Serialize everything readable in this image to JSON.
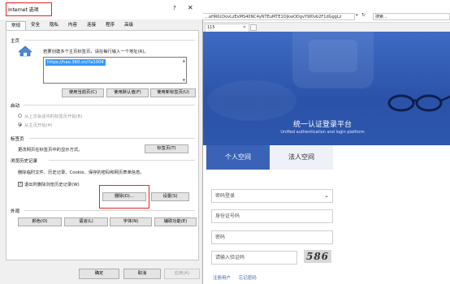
{
  "browser": {
    "url": "…aHR0cDovLzExMS40NC4yNTEuMTE1OjkwODgvYW0vb2F1dGggLz",
    "search_label": "搜索...",
    "tab_label": "115",
    "banner_title": "统一认证登录平台",
    "banner_subtitle": "Unified authentication and login platform",
    "login": {
      "tab_personal": "个人空间",
      "tab_legal": "法人空间",
      "select_value": "密码登录",
      "id_placeholder": "身份证号码",
      "password_placeholder": "密码",
      "captcha_placeholder": "请输入验证码",
      "captcha_text": "586",
      "register_link": "注册用户",
      "forgot_link": "忘记密码"
    }
  },
  "dialog": {
    "title": "Internet 选项",
    "help": "?",
    "close": "✕",
    "tabs": [
      "常规",
      "安全",
      "隐私",
      "内容",
      "连接",
      "程序",
      "高级"
    ],
    "home": {
      "section": "主页",
      "desc": "若要创建多个主页标签页，请在每行输入一个地址(R)。",
      "url": "https://hao.360.cn/?a1004",
      "btn_current": "使用当前页(C)",
      "btn_default": "使用默认值(F)",
      "btn_newtab": "使用新标签页(U)"
    },
    "startup": {
      "section": "启动",
      "opt_last": "从上次会话中的标签页开始(B)",
      "opt_home": "从主页开始(H)"
    },
    "tabs_section": {
      "section": "标签页",
      "desc": "更改网页在标签页中的显示方式。",
      "btn": "标签页(T)"
    },
    "history": {
      "section": "浏览历史记录",
      "desc": "删除临时文件、历史记录、Cookie、保存的密码和网页表单信息。",
      "checkbox": "退出时删除浏览历史记录(W)",
      "btn_delete": "删除(D)...",
      "btn_settings": "设置(S)"
    },
    "appearance": {
      "section": "外观",
      "btn_color": "颜色(O)",
      "btn_language": "语言(L)",
      "btn_font": "字体(N)",
      "btn_access": "辅助功能(E)"
    },
    "footer": {
      "ok": "确定",
      "cancel": "取消",
      "apply": "应用(A)"
    }
  }
}
